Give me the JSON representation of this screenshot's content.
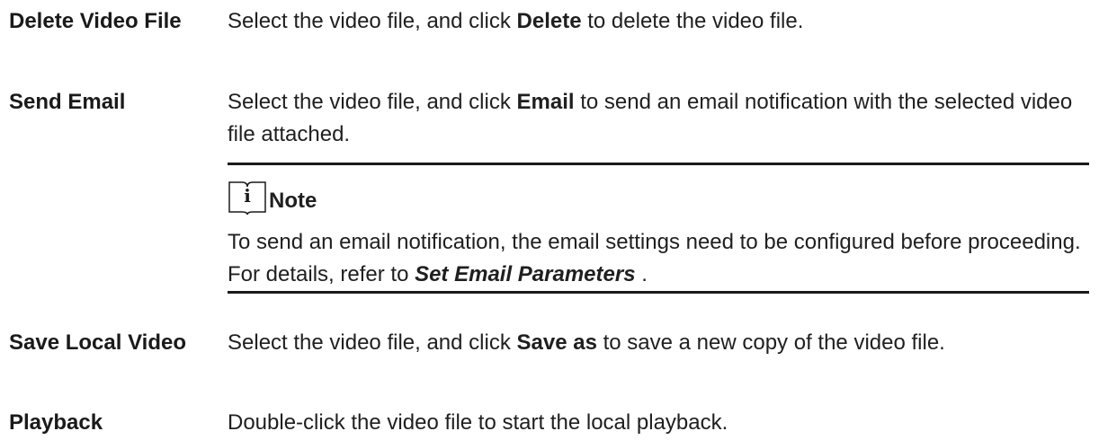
{
  "rows": [
    {
      "term": "Delete Video File",
      "desc_before": "Select the video file, and click ",
      "desc_bold": "Delete",
      "desc_after": " to delete the video file."
    },
    {
      "term": "Send Email",
      "desc_before": "Select the video file, and click ",
      "desc_bold": "Email",
      "desc_after": " to send an email notification with the selected video file attached."
    },
    {
      "term": "Save Local Video",
      "desc_before": "Select the video file, and click ",
      "desc_bold": "Save as",
      "desc_after": " to save a new copy of the video file."
    },
    {
      "term": "Playback",
      "desc": "Double-click the video file to start the local playback."
    }
  ],
  "note": {
    "icon": "info-icon",
    "title": "Note",
    "body_before": "To send an email notification, the email settings need to be configured before proceeding. For details, refer to ",
    "body_link": "Set Email Parameters",
    "body_after": " ."
  }
}
